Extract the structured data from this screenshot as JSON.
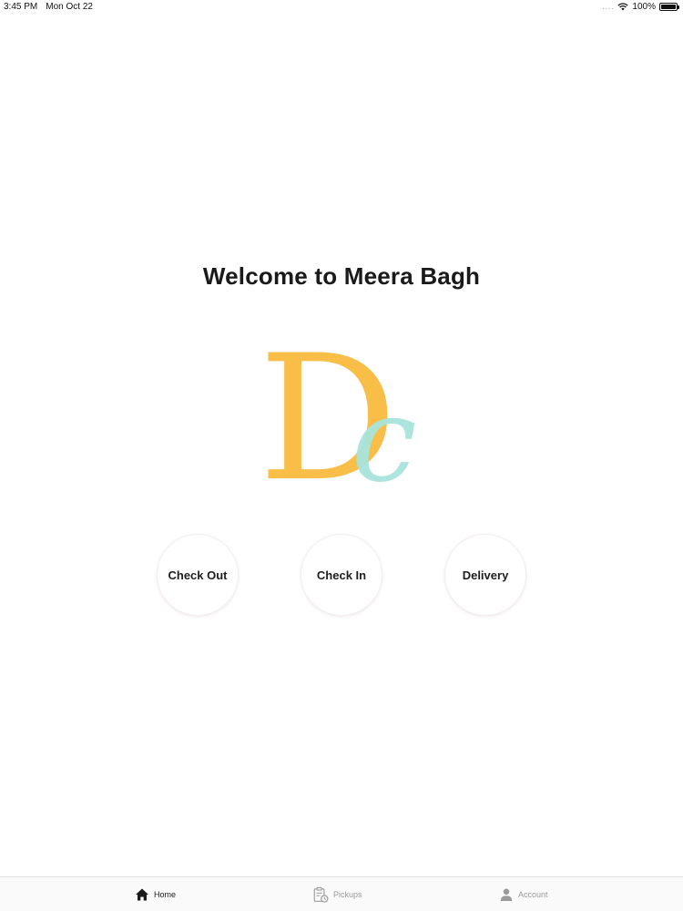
{
  "status_bar": {
    "time": "3:45 PM",
    "date": "Mon Oct 22",
    "signal_dots": "....",
    "battery": "100%",
    "icons": [
      "wifi-icon",
      "battery-icon"
    ]
  },
  "main": {
    "title": "Welcome to Meera Bagh",
    "logo": {
      "letter_primary": "D",
      "letter_secondary": "c",
      "primary_color": "#F9BE48",
      "secondary_color": "#A8E4DC"
    },
    "actions": [
      {
        "label": "Check Out"
      },
      {
        "label": "Check In"
      },
      {
        "label": "Delivery"
      }
    ]
  },
  "tab_bar": {
    "tabs": [
      {
        "label": "Home",
        "icon": "home-icon",
        "active": true
      },
      {
        "label": "Pickups",
        "icon": "clipboard-clock-icon",
        "active": false
      },
      {
        "label": "Account",
        "icon": "person-icon",
        "active": false
      }
    ],
    "active_color": "#1a1a1a",
    "inactive_color": "#9a9a9a"
  }
}
